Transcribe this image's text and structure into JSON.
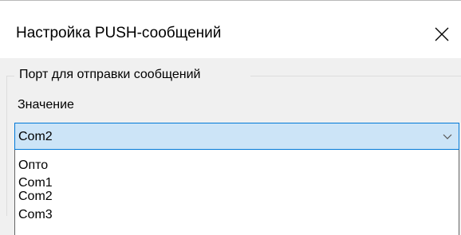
{
  "dialog": {
    "title": "Настройка PUSH-сообщений",
    "close_icon": "close-icon"
  },
  "group": {
    "label": "Порт для отправки сообщений"
  },
  "field": {
    "label": "Значение"
  },
  "combo": {
    "value": "Com2",
    "arrow_icon": "chevron-down-icon"
  },
  "dropdown": {
    "options": [
      {
        "label": "Опто"
      },
      {
        "label": "Com1"
      },
      {
        "label": "Com2"
      },
      {
        "label": "Com3"
      }
    ]
  },
  "colors": {
    "combo_background": "#cce4f7",
    "combo_border": "#0078d7",
    "dialog_background": "#f0f0f0"
  }
}
